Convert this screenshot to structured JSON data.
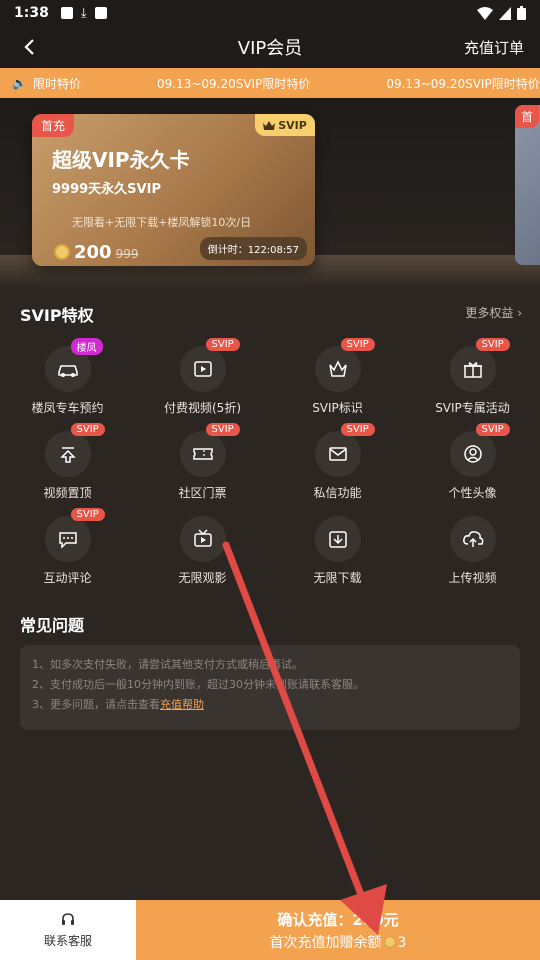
{
  "status": {
    "time": "1:38"
  },
  "nav": {
    "title": "VIP会员",
    "orders": "充值订单"
  },
  "marquee": {
    "label": "限时特价",
    "text1": "09.13~09.20SVIP限时特价",
    "text2": "09.13~09.20SVIP限时特价"
  },
  "card": {
    "first_tag": "首充",
    "svip_tag": "SVIP",
    "name": "超级VIP永久卡",
    "subtitle": "9999天永久SVIP",
    "desc": "无限看+无限下载+楼凤解锁10次/日",
    "price": "200",
    "old_price": "999",
    "countdown": "倒计时：122:08:57"
  },
  "card2": {
    "first_tag": "首"
  },
  "svip": {
    "title": "SVIP特权",
    "more": "更多权益 ›",
    "items": [
      {
        "label": "楼凤专车预约",
        "badge": "楼凤",
        "icon": "car-icon"
      },
      {
        "label": "付费视频(5折)",
        "badge": "SVIP",
        "icon": "film-icon"
      },
      {
        "label": "SVIP标识",
        "badge": "SVIP",
        "icon": "crown-icon"
      },
      {
        "label": "SVIP专属活动",
        "badge": "SVIP",
        "icon": "gift-icon"
      },
      {
        "label": "视频置顶",
        "badge": "SVIP",
        "icon": "pin-top-icon"
      },
      {
        "label": "社区门票",
        "badge": "SVIP",
        "icon": "ticket-icon"
      },
      {
        "label": "私信功能",
        "badge": "SVIP",
        "icon": "mail-icon"
      },
      {
        "label": "个性头像",
        "badge": "SVIP",
        "icon": "avatar-icon"
      },
      {
        "label": "互动评论",
        "badge": "SVIP",
        "icon": "comment-icon"
      },
      {
        "label": "无限观影",
        "badge": "",
        "icon": "tv-icon"
      },
      {
        "label": "无限下载",
        "badge": "",
        "icon": "download-icon"
      },
      {
        "label": "上传视频",
        "badge": "",
        "icon": "cloud-upload-icon"
      }
    ]
  },
  "faq": {
    "title": "常见问题",
    "line1": "1、如多次支付失败，请尝试其他支付方式或稍后再试。",
    "line2": "2、支付成功后一般10分钟内到账，超过30分钟未到账请联系客服。",
    "line3": "3、更多问题，请点击查看",
    "link": "充值帮助"
  },
  "bottom": {
    "service": "联系客服",
    "confirm": "确认充值：200元",
    "bonus_prefix": "首次充值加赠余额",
    "bonus_value": "3"
  },
  "colors": {
    "accent": "#f3a24f",
    "red": "#e8564a",
    "bg": "#2b2622"
  }
}
